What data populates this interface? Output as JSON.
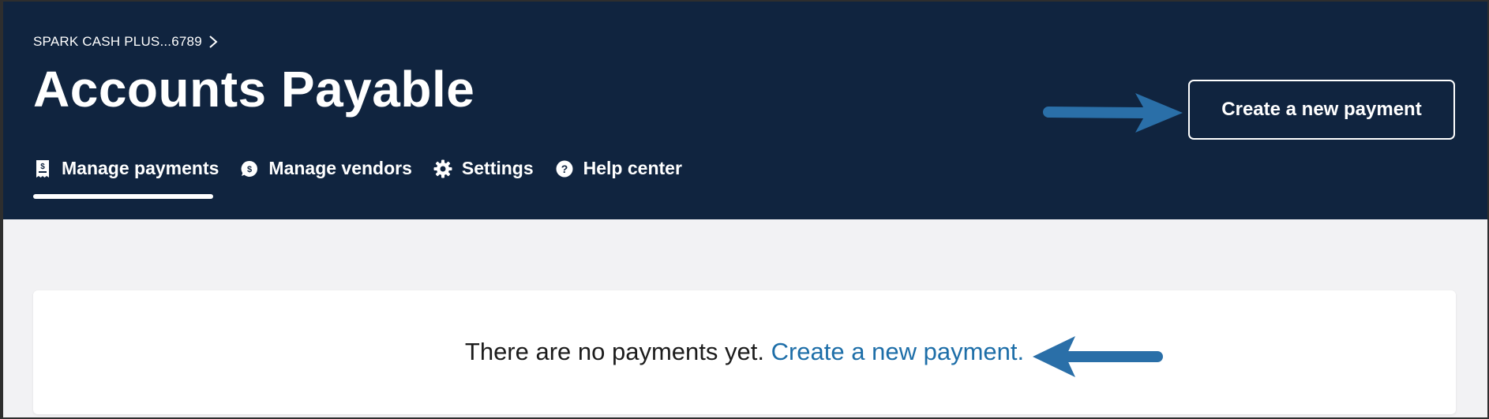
{
  "header": {
    "breadcrumb": "SPARK CASH PLUS...6789",
    "title": "Accounts Payable",
    "create_button": "Create a new payment"
  },
  "nav": {
    "items": [
      {
        "label": "Manage payments",
        "icon": "receipt-dollar-icon",
        "active": true
      },
      {
        "label": "Manage vendors",
        "icon": "dollar-chat-icon",
        "active": false
      },
      {
        "label": "Settings",
        "icon": "gear-icon",
        "active": false
      },
      {
        "label": "Help center",
        "icon": "question-circle-icon",
        "active": false
      }
    ]
  },
  "main": {
    "empty_text": "There are no payments yet.",
    "empty_link": "Create a new payment."
  },
  "colors": {
    "header_bg": "#10243f",
    "page_bg": "#f2f2f4",
    "link": "#1d6ea8",
    "annotation_arrow": "#2a6fa8"
  }
}
